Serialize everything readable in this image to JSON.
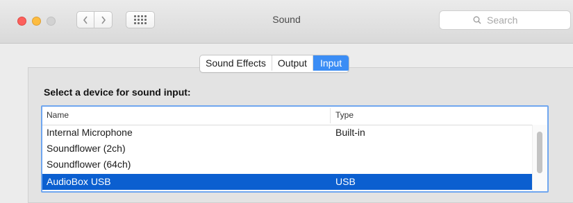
{
  "window": {
    "title": "Sound",
    "search_placeholder": "Search"
  },
  "icons": {
    "back": "chevron-left-icon",
    "forward": "chevron-right-icon",
    "grid": "show-all-grid-icon",
    "search": "magnifier-icon"
  },
  "tabs": [
    {
      "label": "Sound Effects",
      "selected": false
    },
    {
      "label": "Output",
      "selected": false
    },
    {
      "label": "Input",
      "selected": true
    }
  ],
  "input": {
    "heading": "Select a device for sound input:",
    "columns": {
      "name": "Name",
      "type": "Type"
    },
    "devices": [
      {
        "name": "Internal Microphone",
        "type": "Built-in",
        "selected": false
      },
      {
        "name": "Soundflower (2ch)",
        "type": "",
        "selected": false
      },
      {
        "name": "Soundflower (64ch)",
        "type": "",
        "selected": false
      },
      {
        "name": "AudioBox USB",
        "type": "USB",
        "selected": true
      }
    ]
  },
  "colors": {
    "accent": "#3b8df5",
    "selection": "#0b5fd0",
    "close": "#fc605c",
    "minimize": "#fdbc40"
  }
}
